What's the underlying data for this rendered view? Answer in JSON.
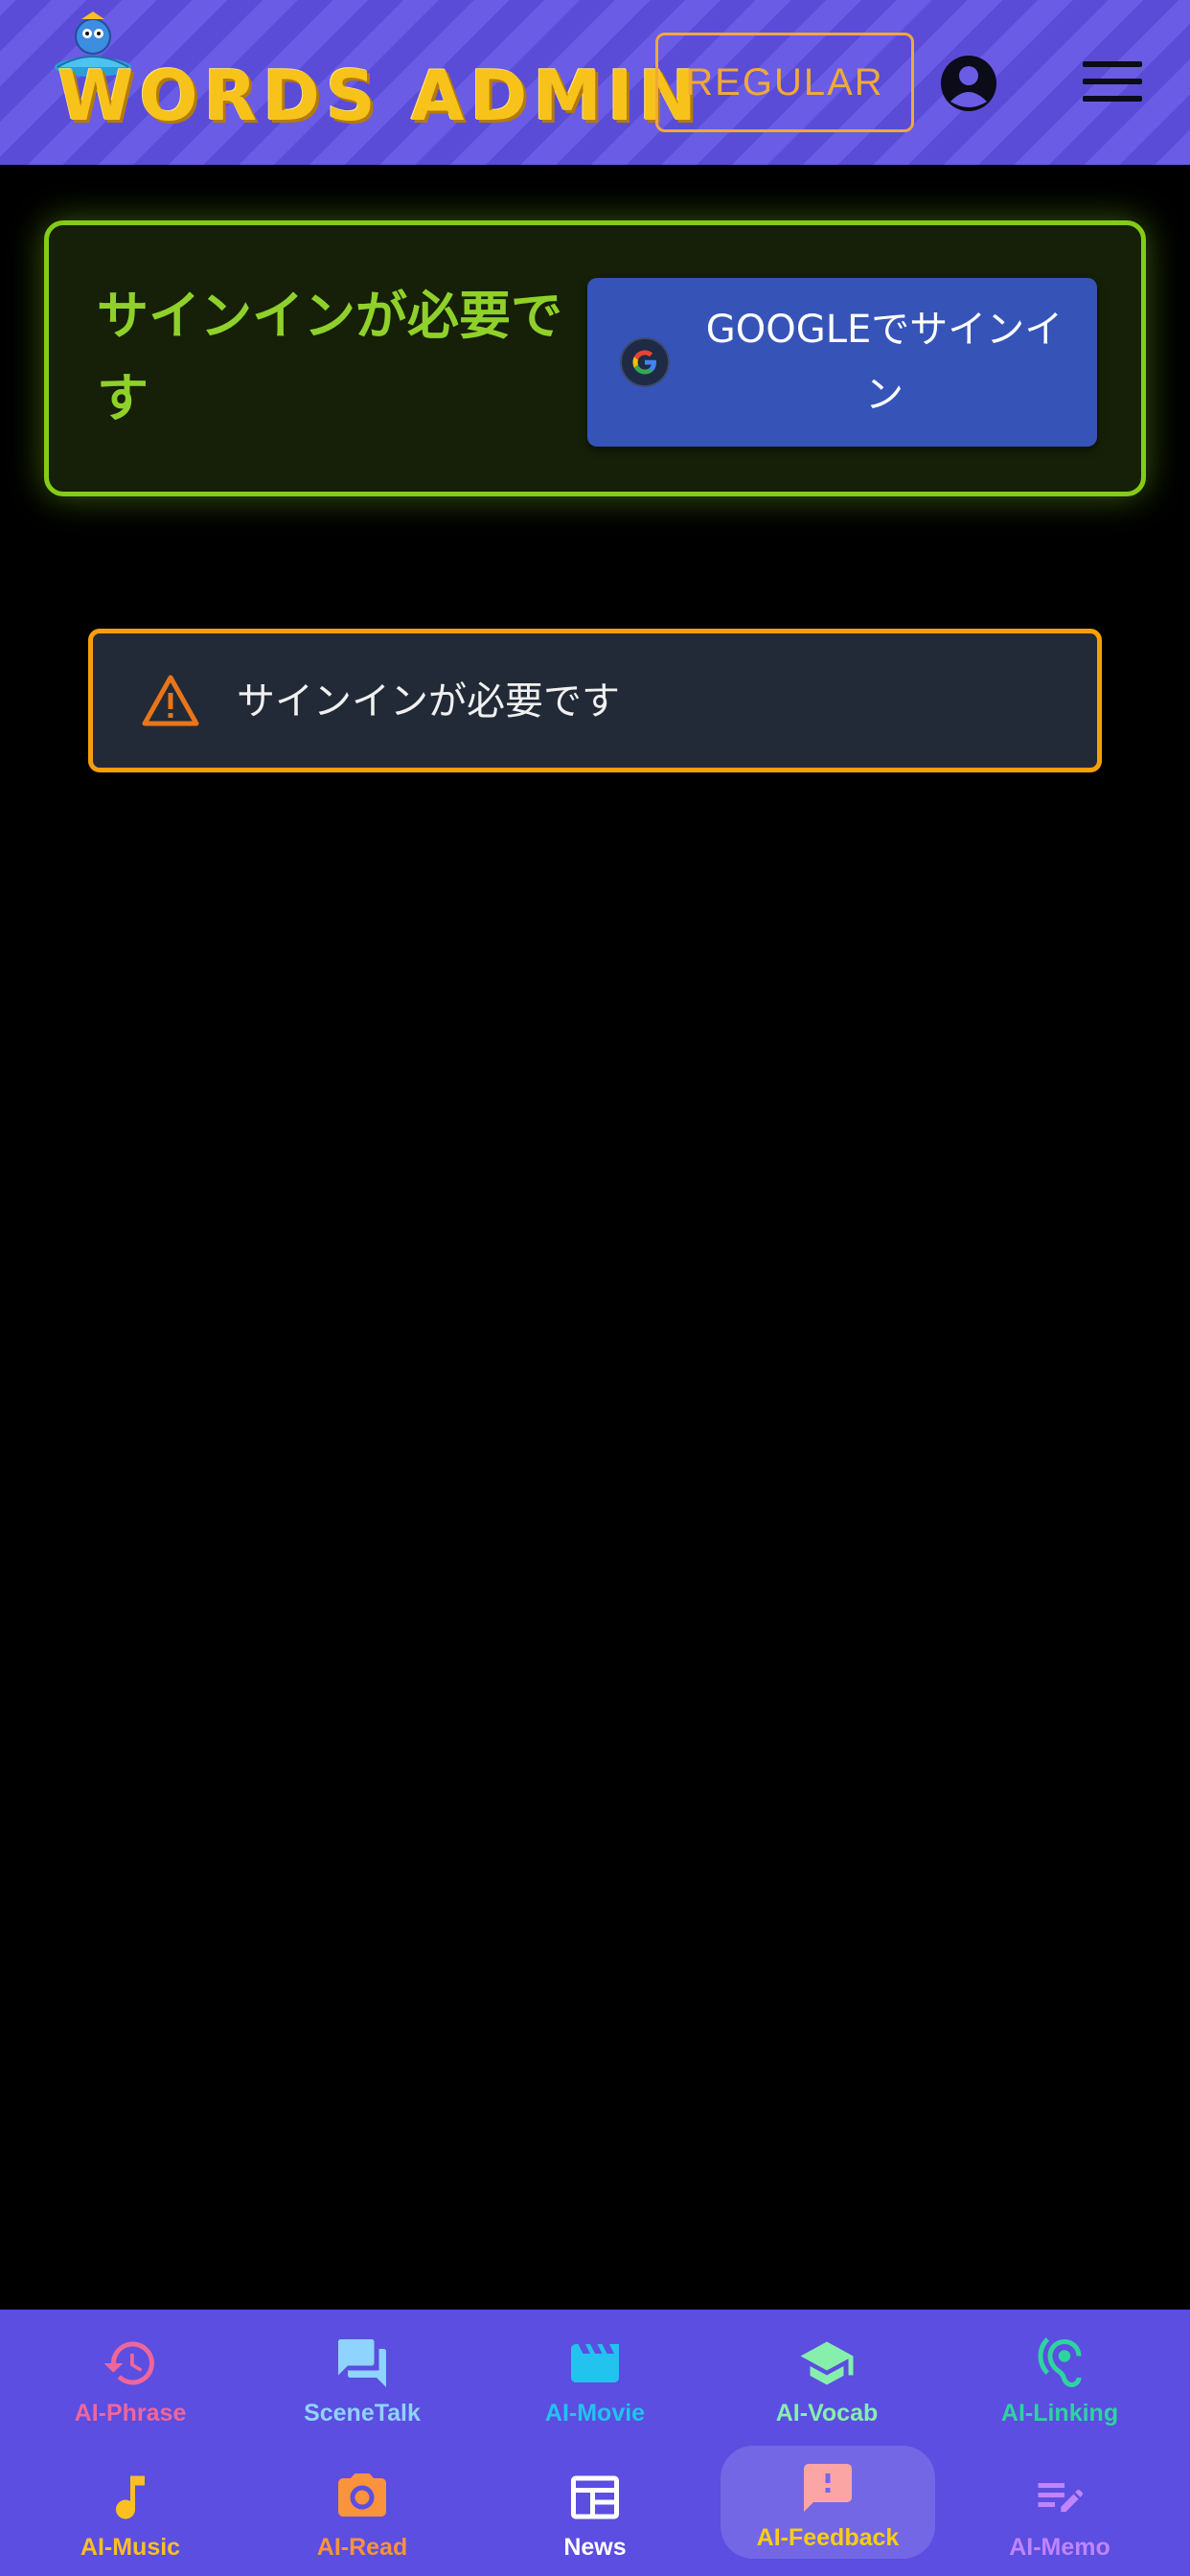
{
  "header": {
    "logo_text": "WORDS ADMIN",
    "plan_badge": "REGULAR",
    "account_icon": "account-circle-icon",
    "menu_icon": "hamburger-menu-icon"
  },
  "signin_card": {
    "title": "サインインが必要です",
    "google_button_label": "GOOGLEでサインイン",
    "google_icon": "google-g-icon"
  },
  "alert": {
    "icon": "warning-triangle-icon",
    "message": "サインインが必要です"
  },
  "bottom_nav": {
    "active": "AI-Feedback",
    "items": [
      {
        "label": "AI-Phrase",
        "icon": "history-icon",
        "color": "#f0669a"
      },
      {
        "label": "SceneTalk",
        "icon": "chat-bubbles-icon",
        "color": "#8fd3ff"
      },
      {
        "label": "AI-Movie",
        "icon": "clapperboard-icon",
        "color": "#22c3ee"
      },
      {
        "label": "AI-Vocab",
        "icon": "graduation-cap-icon",
        "color": "#86efac"
      },
      {
        "label": "AI-Linking",
        "icon": "hearing-ear-icon",
        "color": "#2dd4a0"
      },
      {
        "label": "AI-Music",
        "icon": "music-note-icon",
        "color": "#fbbf24"
      },
      {
        "label": "AI-Read",
        "icon": "camera-icon",
        "color": "#fb923c"
      },
      {
        "label": "News",
        "icon": "newspaper-icon",
        "color": "#ffffff"
      },
      {
        "label": "AI-Feedback",
        "icon": "feedback-alert-icon",
        "color": "#facc15"
      },
      {
        "label": "AI-Memo",
        "icon": "edit-note-icon",
        "color": "#c084fc"
      }
    ]
  },
  "colors": {
    "header_stripe_a": "#6a5ce4",
    "header_stripe_b": "#5a4cd6",
    "logo": "#f7c21a",
    "badge": "#f0a93a",
    "card_border": "#84cc16",
    "google_button": "#3653b8",
    "alert_border": "#f5a00b",
    "nav_bg": "#5b4ee0"
  }
}
